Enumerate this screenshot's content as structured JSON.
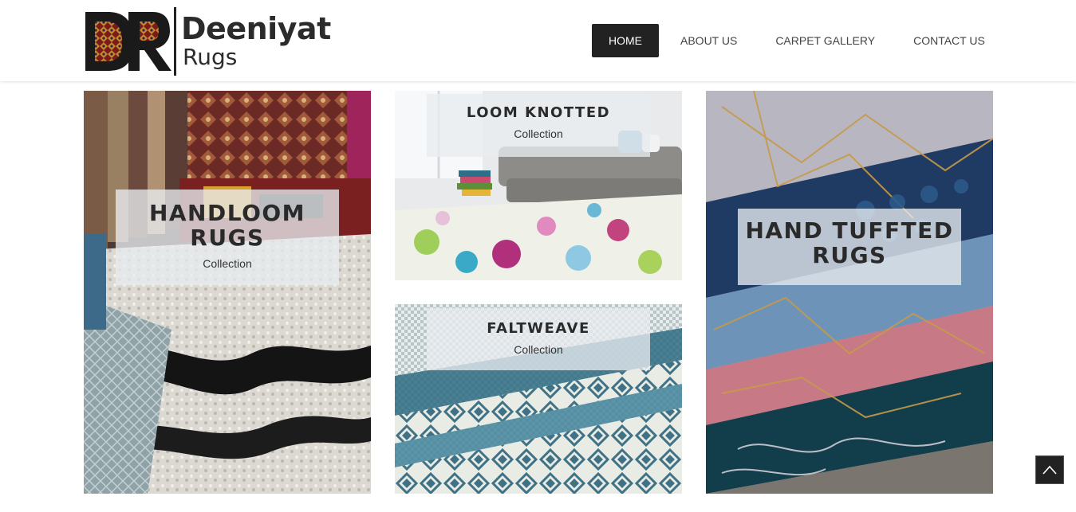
{
  "brand": {
    "name": "Deeniyat",
    "subtitle": "Rugs",
    "monogram": "DR",
    "colors": {
      "text": "#2b2b2b",
      "monogram_fill": "#1a1a1a",
      "accent_red": "#8a1f1f"
    }
  },
  "nav": {
    "items": [
      {
        "label": "HOME",
        "active": true
      },
      {
        "label": "ABOUT US",
        "active": false
      },
      {
        "label": "CARPET GALLERY",
        "active": false
      },
      {
        "label": "CONTACT US",
        "active": false
      }
    ],
    "active_bg": "#222222"
  },
  "collections": {
    "handloom": {
      "title_line1": "HANDLOOM",
      "title_line2": "RUGS",
      "subtitle": "Collection"
    },
    "loom_knotted": {
      "title": "LOOM KNOTTED",
      "subtitle": "Collection"
    },
    "flatweave": {
      "title": "FALTWEAVE",
      "subtitle": "Collection"
    },
    "hand_tufted": {
      "title_line1": "HAND TUFFTED",
      "title_line2": "RUGS"
    }
  },
  "scroll_top": {
    "icon": "chevron-up-icon"
  }
}
